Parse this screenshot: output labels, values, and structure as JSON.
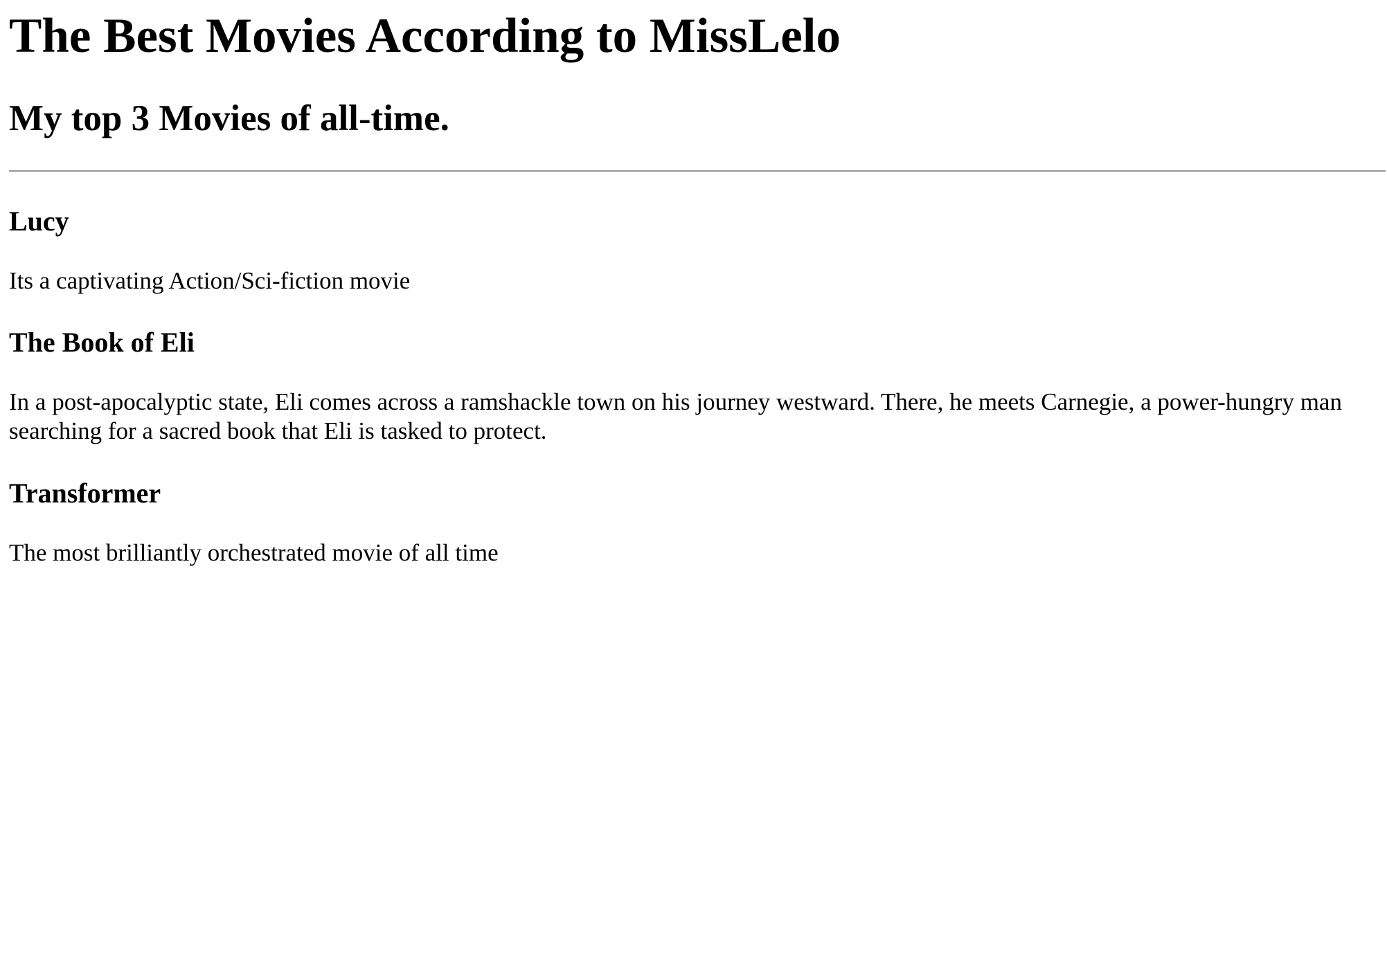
{
  "page": {
    "title": "The Best Movies According to MissLelo",
    "subtitle": "My top 3 Movies of all-time."
  },
  "movies": [
    {
      "title": "Lucy",
      "description": "Its a captivating Action/Sci-fiction movie"
    },
    {
      "title": "The Book of Eli",
      "description": "In a post-apocalyptic state, Eli comes across a ramshackle town on his journey westward. There, he meets Carnegie, a power-hungry man searching for a sacred book that Eli is tasked to protect."
    },
    {
      "title": "Transformer",
      "description": "The most brilliantly orchestrated movie of all time"
    }
  ]
}
